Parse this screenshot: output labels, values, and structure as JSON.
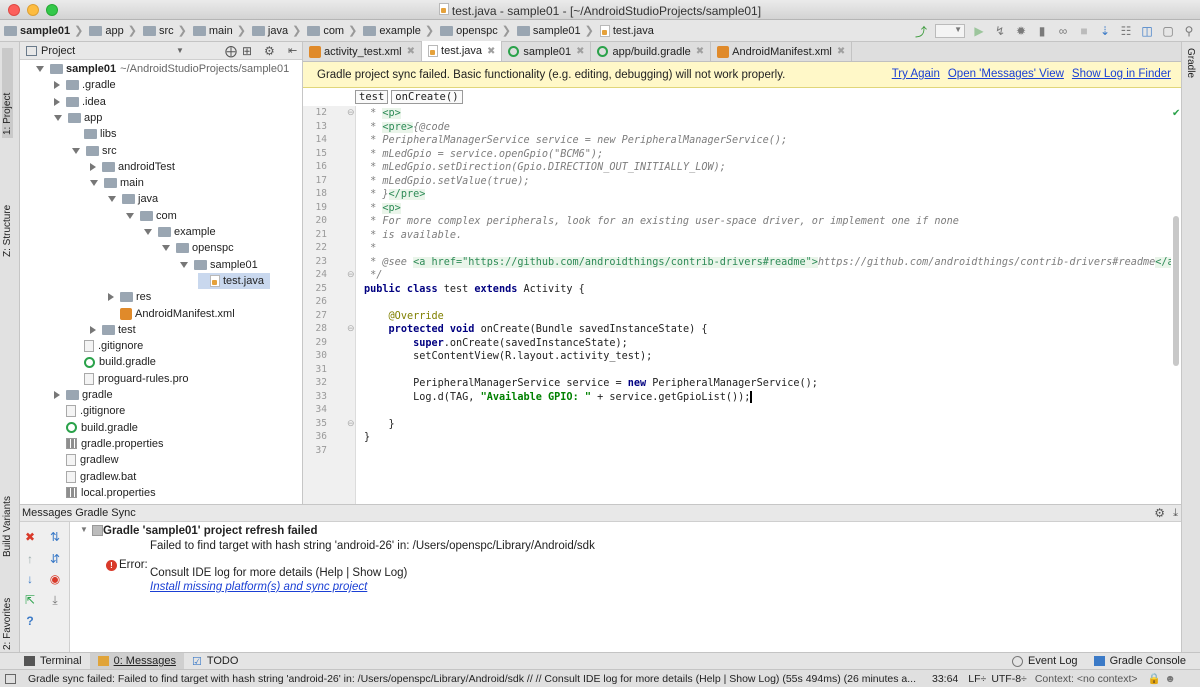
{
  "window": {
    "title": "test.java - sample01 - [~/AndroidStudioProjects/sample01]"
  },
  "breadcrumbs": [
    "sample01",
    "app",
    "src",
    "main",
    "java",
    "com",
    "example",
    "openspc",
    "sample01",
    "test.java"
  ],
  "left_stripe": {
    "project": "1: Project",
    "structure": "Z: Structure",
    "build_variants": "Build Variants",
    "favorites": "2: Favorites"
  },
  "right_stripe": {
    "gradle": "Gradle"
  },
  "project_panel": {
    "view_selector": "Project",
    "root_label": "sample01",
    "root_path": "~/AndroidStudioProjects/sample01",
    "tree": [
      {
        "label": "sample01",
        "extra": "~/AndroidStudioProjects/sample01",
        "depth": 0,
        "state": "open",
        "icon": "module",
        "bold": true
      },
      {
        "label": ".gradle",
        "depth": 1,
        "state": "closed",
        "icon": "folder"
      },
      {
        "label": ".idea",
        "depth": 1,
        "state": "closed",
        "icon": "folder"
      },
      {
        "label": "app",
        "depth": 1,
        "state": "open",
        "icon": "folder"
      },
      {
        "label": "libs",
        "depth": 2,
        "state": "none",
        "icon": "folder"
      },
      {
        "label": "src",
        "depth": 2,
        "state": "open",
        "icon": "folder"
      },
      {
        "label": "androidTest",
        "depth": 3,
        "state": "closed",
        "icon": "folder"
      },
      {
        "label": "main",
        "depth": 3,
        "state": "open",
        "icon": "folder"
      },
      {
        "label": "java",
        "depth": 4,
        "state": "open",
        "icon": "folder"
      },
      {
        "label": "com",
        "depth": 5,
        "state": "open",
        "icon": "folder"
      },
      {
        "label": "example",
        "depth": 6,
        "state": "open",
        "icon": "folder"
      },
      {
        "label": "openspc",
        "depth": 7,
        "state": "open",
        "icon": "folder"
      },
      {
        "label": "sample01",
        "depth": 8,
        "state": "open",
        "icon": "folder"
      },
      {
        "label": "test.java",
        "depth": 9,
        "state": "none",
        "icon": "java",
        "selected": true
      },
      {
        "label": "res",
        "depth": 4,
        "state": "closed",
        "icon": "folder"
      },
      {
        "label": "AndroidManifest.xml",
        "depth": 4,
        "state": "none",
        "icon": "xml"
      },
      {
        "label": "test",
        "depth": 3,
        "state": "closed",
        "icon": "folder"
      },
      {
        "label": ".gitignore",
        "depth": 2,
        "state": "none",
        "icon": "file"
      },
      {
        "label": "build.gradle",
        "depth": 2,
        "state": "none",
        "icon": "gradle"
      },
      {
        "label": "proguard-rules.pro",
        "depth": 2,
        "state": "none",
        "icon": "file"
      },
      {
        "label": "gradle",
        "depth": 1,
        "state": "closed",
        "icon": "folder"
      },
      {
        "label": ".gitignore",
        "depth": 1,
        "state": "none",
        "icon": "file"
      },
      {
        "label": "build.gradle",
        "depth": 1,
        "state": "none",
        "icon": "gradle"
      },
      {
        "label": "gradle.properties",
        "depth": 1,
        "state": "none",
        "icon": "props"
      },
      {
        "label": "gradlew",
        "depth": 1,
        "state": "none",
        "icon": "file"
      },
      {
        "label": "gradlew.bat",
        "depth": 1,
        "state": "none",
        "icon": "file"
      },
      {
        "label": "local.properties",
        "depth": 1,
        "state": "none",
        "icon": "props"
      }
    ]
  },
  "editor_tabs": [
    {
      "label": "activity_test.xml",
      "icon": "xml"
    },
    {
      "label": "test.java",
      "icon": "java",
      "active": true
    },
    {
      "label": "sample01",
      "icon": "gradle"
    },
    {
      "label": "app/build.gradle",
      "icon": "gradle"
    },
    {
      "label": "AndroidManifest.xml",
      "icon": "xml"
    }
  ],
  "banner": {
    "message": "Gradle project sync failed. Basic functionality (e.g. editing, debugging) will not work properly.",
    "links": [
      "Try Again",
      "Open 'Messages' View",
      "Show Log in Finder"
    ]
  },
  "editor_breadcrumbs": [
    "test",
    "onCreate()"
  ],
  "code": {
    "line_numbers": [
      "12",
      "13",
      "14",
      "15",
      "16",
      "17",
      "18",
      "19",
      "20",
      "21",
      "22",
      "23",
      "24",
      "25",
      "26",
      "27",
      "28",
      "29",
      "30",
      "31",
      "32",
      "33",
      "34",
      "35",
      "36",
      "37"
    ],
    "lines": [
      [
        {
          "t": " * ",
          "c": "c-com"
        },
        {
          "t": "<p>",
          "c": "c-tag"
        }
      ],
      [
        {
          "t": " * ",
          "c": "c-com"
        },
        {
          "t": "<pre>",
          "c": "c-tag"
        },
        {
          "t": "{@code",
          "c": "c-com"
        }
      ],
      [
        {
          "t": " * PeripheralManagerService service = new PeripheralManagerService();",
          "c": "c-com"
        }
      ],
      [
        {
          "t": " * mLedGpio = service.openGpio(\"BCM6\");",
          "c": "c-com"
        }
      ],
      [
        {
          "t": " * mLedGpio.setDirection(Gpio.DIRECTION_OUT_INITIALLY_LOW);",
          "c": "c-com"
        }
      ],
      [
        {
          "t": " * mLedGpio.setValue(true);",
          "c": "c-com"
        }
      ],
      [
        {
          "t": " * }",
          "c": "c-com"
        },
        {
          "t": "</pre>",
          "c": "c-tag"
        }
      ],
      [
        {
          "t": " * ",
          "c": "c-com"
        },
        {
          "t": "<p>",
          "c": "c-tag"
        }
      ],
      [
        {
          "t": " * For more complex peripherals, look for an existing user-space driver, or implement one if none",
          "c": "c-com"
        }
      ],
      [
        {
          "t": " * is available.",
          "c": "c-com"
        }
      ],
      [
        {
          "t": " *",
          "c": "c-com"
        }
      ],
      [
        {
          "t": " * ",
          "c": "c-com"
        },
        {
          "t": "@see",
          "c": "c-com"
        },
        {
          "t": " ",
          "c": "c-com"
        },
        {
          "t": "<a href=\"https://github.com/androidthings/contrib-drivers#readme\">",
          "c": "c-tag"
        },
        {
          "t": "https://github.com/androidthings/contrib-drivers#readme",
          "c": "c-com"
        },
        {
          "t": "</a>",
          "c": "c-tag"
        }
      ],
      [
        {
          "t": " */",
          "c": "c-com"
        }
      ],
      [
        {
          "t": "public class ",
          "c": "c-kw"
        },
        {
          "t": "test ",
          "c": ""
        },
        {
          "t": "extends ",
          "c": "c-kw"
        },
        {
          "t": "Activity {",
          "c": ""
        }
      ],
      [
        {
          "t": "",
          "c": ""
        }
      ],
      [
        {
          "t": "    ",
          "c": ""
        },
        {
          "t": "@Override",
          "c": "c-ann"
        }
      ],
      [
        {
          "t": "    ",
          "c": ""
        },
        {
          "t": "protected void ",
          "c": "c-kw"
        },
        {
          "t": "onCreate(Bundle savedInstanceState) {",
          "c": ""
        }
      ],
      [
        {
          "t": "        ",
          "c": ""
        },
        {
          "t": "super",
          "c": "c-kw"
        },
        {
          "t": ".onCreate(savedInstanceState);",
          "c": ""
        }
      ],
      [
        {
          "t": "        setContentView(R.layout.",
          "c": ""
        },
        {
          "t": "activity_test",
          "c": ""
        },
        {
          "t": ");",
          "c": ""
        }
      ],
      [
        {
          "t": "",
          "c": ""
        }
      ],
      [
        {
          "t": "        PeripheralManagerService service = ",
          "c": ""
        },
        {
          "t": "new ",
          "c": "c-kw"
        },
        {
          "t": "PeripheralManagerService();",
          "c": ""
        }
      ],
      [
        {
          "t": "        Log.d(",
          "c": ""
        },
        {
          "t": "TAG",
          "c": ""
        },
        {
          "t": ", ",
          "c": ""
        },
        {
          "t": "\"Available GPIO: \"",
          "c": "c-str"
        },
        {
          "t": " + service.getGpioList());",
          "c": ""
        }
      ],
      [
        {
          "t": "",
          "c": ""
        }
      ],
      [
        {
          "t": "    }",
          "c": ""
        }
      ],
      [
        {
          "t": "}",
          "c": ""
        }
      ],
      [
        {
          "t": "",
          "c": ""
        }
      ]
    ]
  },
  "messages_panel": {
    "title": "Messages Gradle Sync",
    "heading": "Gradle 'sample01' project refresh failed",
    "error_label": "Error:",
    "lines": [
      "Failed to find target with hash string 'android-26' in: /Users/openspc/Library/Android/sdk",
      "Consult IDE log for more details (Help | Show Log)"
    ],
    "link": "Install missing platform(s) and sync project"
  },
  "bottom_tabs": {
    "terminal": "Terminal",
    "messages": "0: Messages",
    "todo": "TODO",
    "event_log": "Event Log",
    "gradle_console": "Gradle Console"
  },
  "status_bar": {
    "message": "Gradle sync failed: Failed to find target with hash string 'android-26' in: /Users/openspc/Library/Android/sdk // // Consult IDE log for more details (Help | Show Log) (55s 494ms) (26 minutes a...",
    "position": "33:64",
    "line_sep": "LF÷",
    "encoding": "UTF-8÷",
    "context": "Context: <no context>"
  },
  "colors": {
    "banner_bg": "#fff8c8",
    "link": "#1a3fd4",
    "error": "#d93a2a",
    "gradle_green": "#2aa24a"
  }
}
